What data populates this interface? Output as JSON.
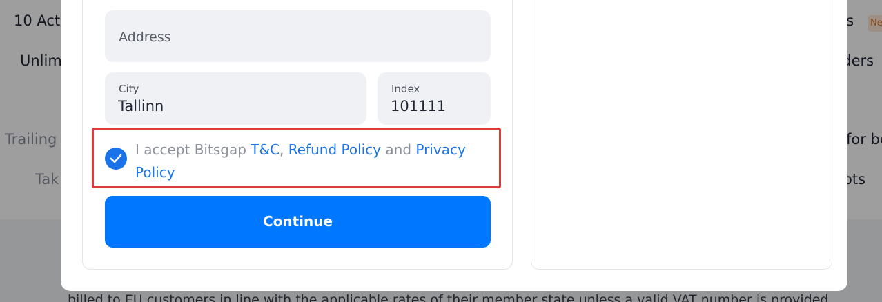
{
  "background": {
    "left_items": [
      "10 Act",
      "Unlim",
      "Trailing",
      "Tak"
    ],
    "right_items": [
      "ts",
      "rders",
      "for be",
      "ots"
    ],
    "badge": "Ne",
    "footer_text": "billed to EU customers in line with the applicable rates of their member state unless a valid VAT number is provided"
  },
  "form": {
    "address_placeholder": "Address",
    "city_label": "City",
    "city_value": "Tallinn",
    "index_label": "Index",
    "index_value": "101111",
    "consent": {
      "prefix": "I accept Bitsgap ",
      "tc_link": "T&C",
      "comma": ", ",
      "refund_link": "Refund Policy",
      "and": " and ",
      "privacy_link": "Privacy Policy",
      "checked": true
    },
    "continue_label": "Continue"
  },
  "colors": {
    "accent": "#0077ff",
    "link": "#1a73e8",
    "highlight_border": "#dd3c3c"
  }
}
